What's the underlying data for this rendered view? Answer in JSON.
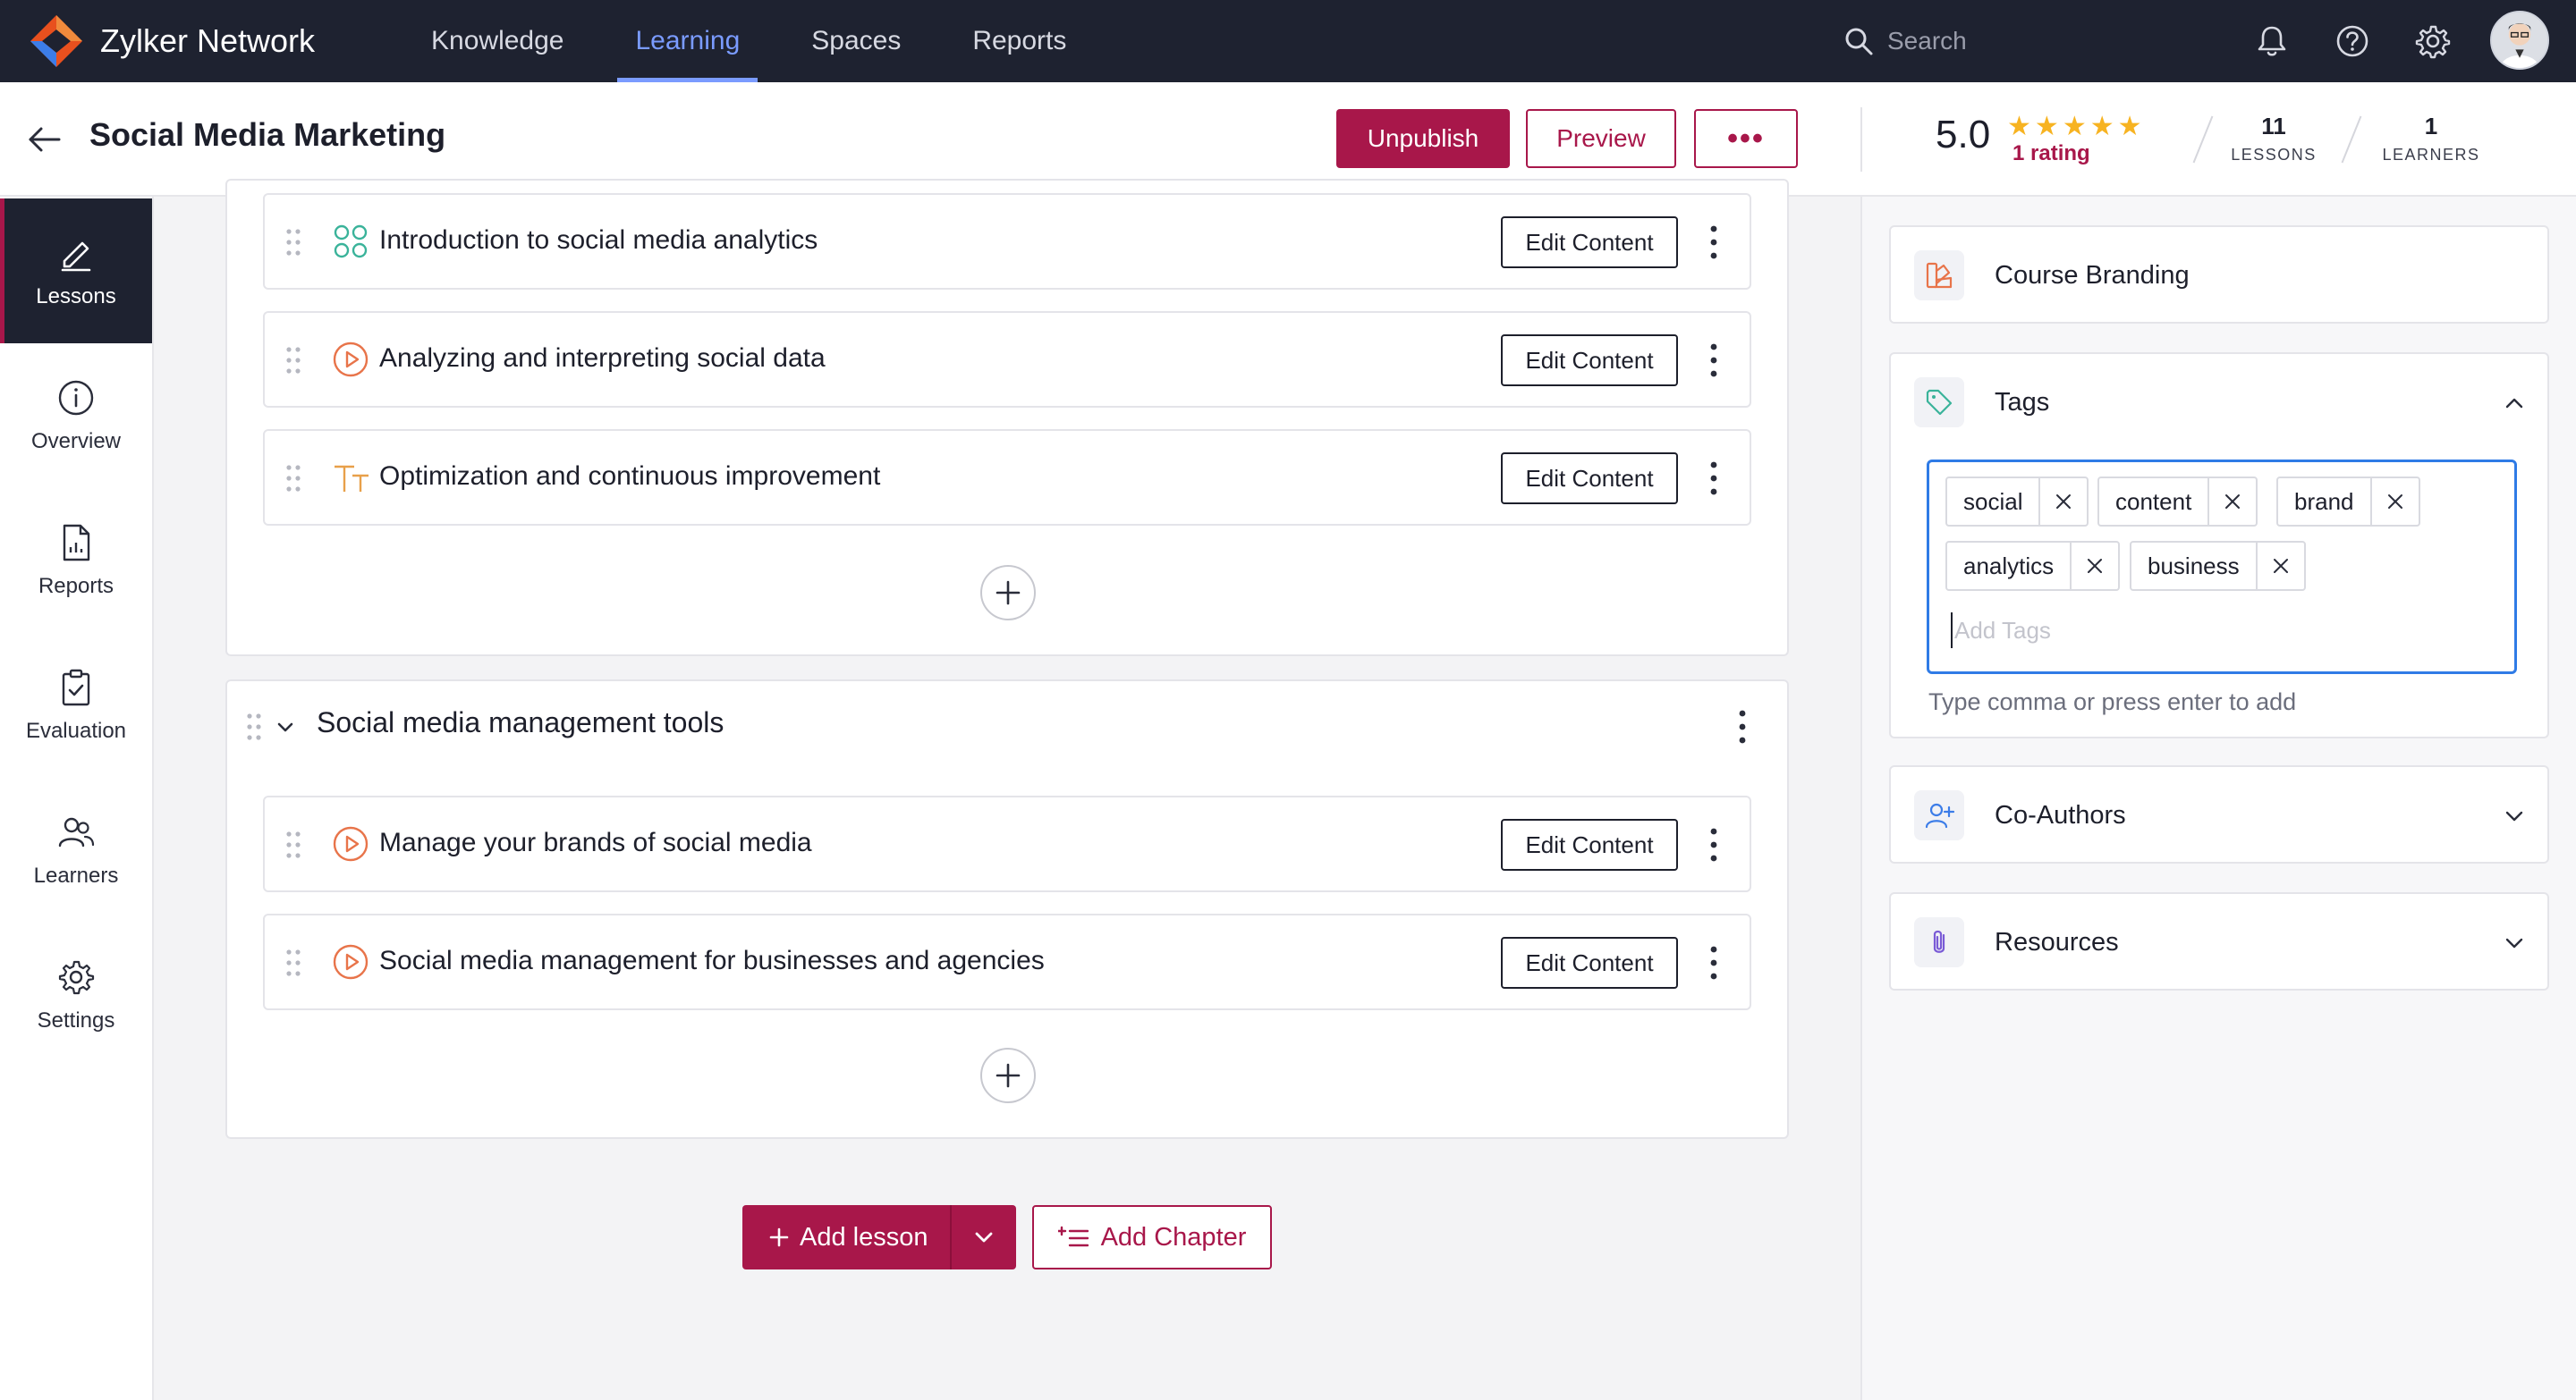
{
  "app": {
    "name": "Zylker Network"
  },
  "nav": {
    "tabs": [
      {
        "label": "Knowledge"
      },
      {
        "label": "Learning"
      },
      {
        "label": "Spaces"
      },
      {
        "label": "Reports"
      }
    ],
    "active_tab": "Learning",
    "search_placeholder": "Search"
  },
  "course": {
    "title": "Social Media Marketing",
    "rating": "5.0",
    "stars": 5,
    "rating_count": "1 rating",
    "lessons_count": "11",
    "lessons_label": "LESSONS",
    "learners_count": "1",
    "learners_label": "LEARNERS"
  },
  "header_actions": {
    "unpublish": "Unpublish",
    "preview": "Preview",
    "more": "•••"
  },
  "sidebar": {
    "items": [
      {
        "label": "Lessons",
        "icon": "pencil-icon",
        "active": true
      },
      {
        "label": "Overview",
        "icon": "info-icon"
      },
      {
        "label": "Reports",
        "icon": "report-icon"
      },
      {
        "label": "Evaluation",
        "icon": "clipboard-check-icon"
      },
      {
        "label": "Learners",
        "icon": "users-icon"
      },
      {
        "label": "Settings",
        "icon": "gear-icon"
      }
    ]
  },
  "chapters": [
    {
      "title": "",
      "lessons": [
        {
          "title": "Introduction to social media analytics",
          "icon": "scorm-icon",
          "action": "Edit Content"
        },
        {
          "title": "Analyzing and interpreting social data",
          "icon": "play-circle-icon",
          "action": "Edit Content"
        },
        {
          "title": "Optimization and continuous improvement",
          "icon": "text-icon",
          "action": "Edit Content"
        }
      ]
    },
    {
      "title": "Social media management tools",
      "lessons": [
        {
          "title": "Manage your brands of social media",
          "icon": "play-circle-icon",
          "action": "Edit Content"
        },
        {
          "title": "Social media management for businesses and agencies",
          "icon": "play-circle-icon",
          "action": "Edit Content"
        }
      ]
    }
  ],
  "footer_actions": {
    "add_lesson": "Add lesson",
    "add_chapter": "Add Chapter"
  },
  "right_panel": {
    "course_branding": "Course Branding",
    "tags": {
      "title": "Tags",
      "items": [
        "social",
        "content",
        "brand",
        "analytics",
        "business"
      ],
      "placeholder": "Add Tags",
      "hint": "Type comma or press enter to add"
    },
    "co_authors": "Co-Authors",
    "resources": "Resources"
  },
  "colors": {
    "brand": "#a8174a",
    "nav_bg": "#1e2230",
    "accent": "#7a9bff",
    "focus": "#2f7be6",
    "star": "#f7b321",
    "lesson_icon": "#e8744a"
  }
}
